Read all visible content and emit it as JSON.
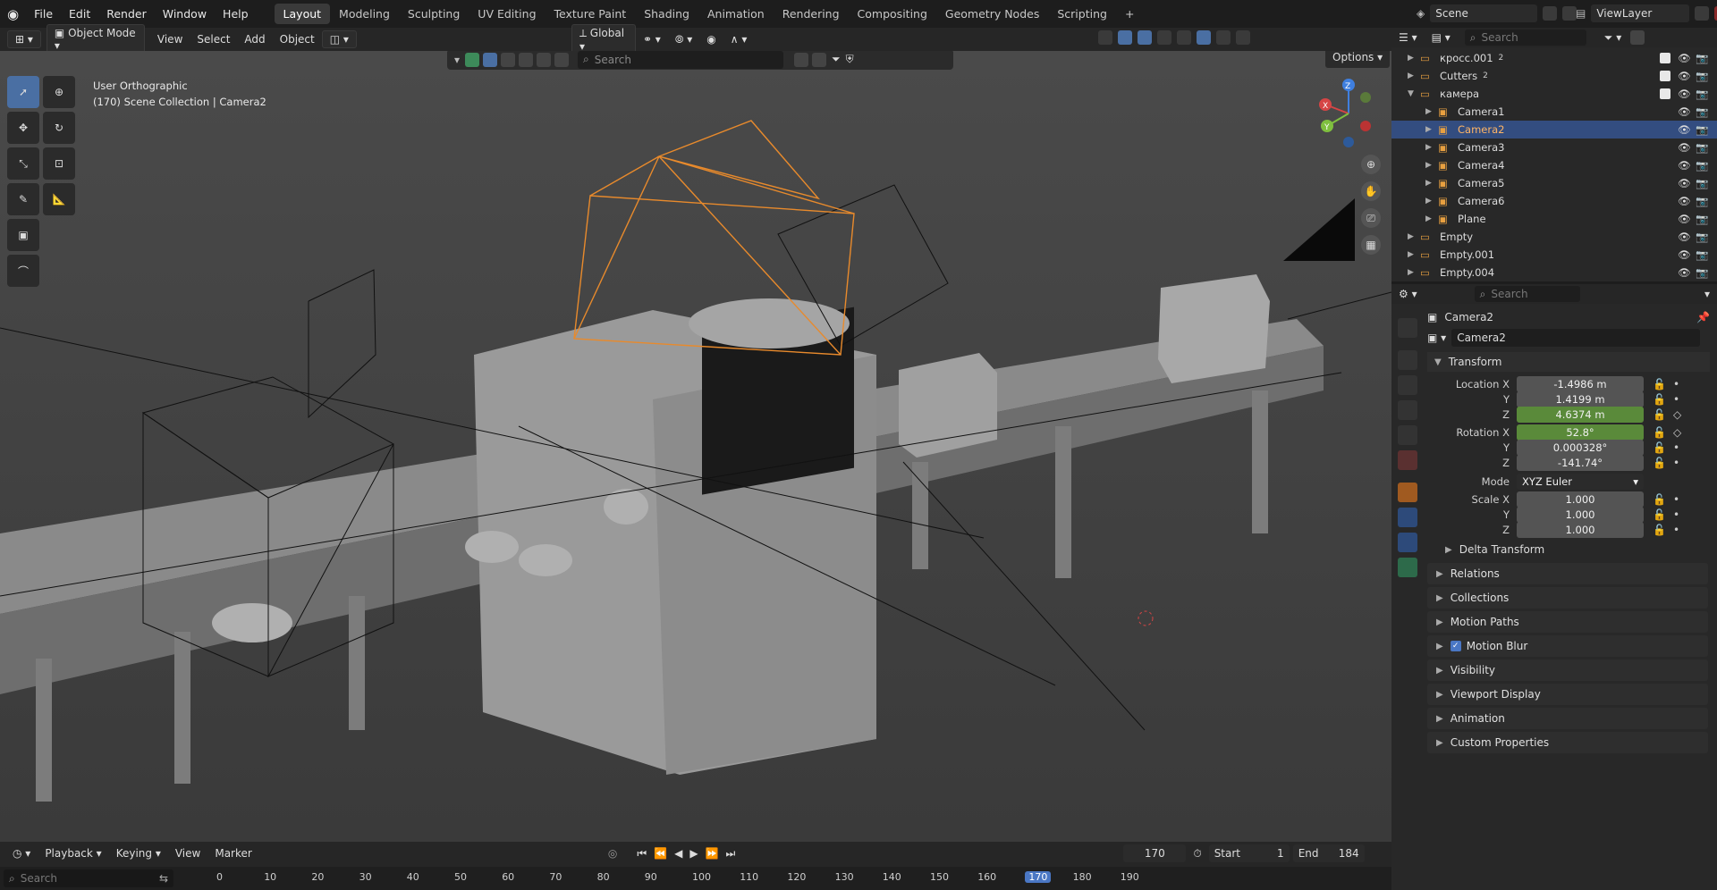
{
  "menu": [
    "File",
    "Edit",
    "Render",
    "Window",
    "Help"
  ],
  "workspaces": [
    "Layout",
    "Modeling",
    "Sculpting",
    "UV Editing",
    "Texture Paint",
    "Shading",
    "Animation",
    "Rendering",
    "Compositing",
    "Geometry Nodes",
    "Scripting"
  ],
  "active_workspace": "Layout",
  "add_workspace": "+",
  "scene_name": "Scene",
  "view_layer": "ViewLayer",
  "viewport_header": {
    "mode": "Object Mode",
    "menus": [
      "View",
      "Select",
      "Add",
      "Object"
    ],
    "orientation": "Global",
    "options": "Options",
    "search_placeholder": "Search"
  },
  "viewport": {
    "view_name": "User Orthographic",
    "collection_info": "(170) Scene Collection | Camera2",
    "gizmo_axes": [
      "Z",
      "X",
      "Y"
    ]
  },
  "outliner": {
    "search_placeholder": "Search",
    "items": [
      {
        "label": "кросс.001",
        "badge": "2",
        "indent": 0,
        "checked": true
      },
      {
        "label": "Cutters",
        "badge": "2",
        "indent": 0,
        "checked": true
      },
      {
        "label": "камера",
        "badge": "",
        "indent": 0,
        "checked": true,
        "expanded": true
      },
      {
        "label": "Camera1",
        "badge": "",
        "indent": 1
      },
      {
        "label": "Camera2",
        "badge": "",
        "indent": 1,
        "selected": true
      },
      {
        "label": "Camera3",
        "badge": "",
        "indent": 1
      },
      {
        "label": "Camera4",
        "badge": "",
        "indent": 1
      },
      {
        "label": "Camera5",
        "badge": "",
        "indent": 1
      },
      {
        "label": "Camera6",
        "badge": "",
        "indent": 1
      },
      {
        "label": "Plane",
        "badge": "",
        "indent": 1
      },
      {
        "label": "Empty",
        "badge": "",
        "indent": 0
      },
      {
        "label": "Empty.001",
        "badge": "",
        "indent": 0
      },
      {
        "label": "Empty.004",
        "badge": "",
        "indent": 0
      }
    ]
  },
  "properties": {
    "search_placeholder": "Search",
    "object_name": "Camera2",
    "object_field": "Camera2",
    "transform_title": "Transform",
    "location": {
      "label": "Location X",
      "x": "-1.4986 m",
      "y": "1.4199 m",
      "z": "4.6374 m"
    },
    "rotation": {
      "label": "Rotation X",
      "x": "52.8°",
      "y": "0.000328°",
      "z": "-141.74°"
    },
    "mode_label": "Mode",
    "mode_value": "XYZ Euler",
    "scale": {
      "label": "Scale X",
      "x": "1.000",
      "y": "1.000",
      "z": "1.000"
    },
    "axis_labels": {
      "y": "Y",
      "z": "Z"
    },
    "delta_transform": "Delta Transform",
    "panels": [
      "Relations",
      "Collections",
      "Motion Paths",
      "Motion Blur",
      "Visibility",
      "Viewport Display",
      "Animation",
      "Custom Properties"
    ]
  },
  "timeline": {
    "menus": [
      "Playback",
      "Keying",
      "View",
      "Marker"
    ],
    "current_frame": "170",
    "start_label": "Start",
    "start": "1",
    "end_label": "End",
    "end": "184",
    "search_placeholder": "Search",
    "ruler": [
      "0",
      "10",
      "20",
      "30",
      "40",
      "50",
      "60",
      "70",
      "80",
      "90",
      "100",
      "110",
      "120",
      "130",
      "140",
      "150",
      "160",
      "170",
      "180",
      "190"
    ]
  },
  "colors": {
    "accent_blue": "#4a6fa3",
    "selection": "#334d80",
    "keyed_green": "#5a8a3a",
    "camera_orange": "#e88a2c",
    "axis_x": "#d64545",
    "axis_y": "#7fbf3f",
    "axis_z": "#3f7fdf"
  }
}
